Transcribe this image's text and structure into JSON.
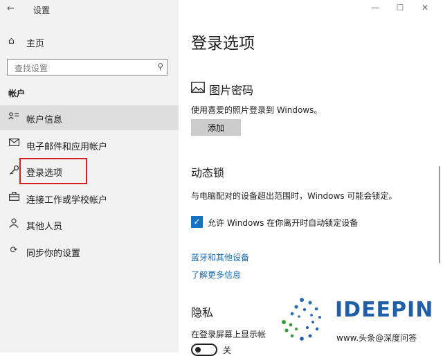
{
  "window": {
    "title": "设置",
    "back_glyph": "←",
    "controls": [
      "—",
      "☐",
      "✕"
    ]
  },
  "sidebar": {
    "home_label": "主页",
    "search_placeholder": "查找设置",
    "section_label": "帐户",
    "items": [
      {
        "label": "帐户信息",
        "icon": "person-card-icon",
        "active": true
      },
      {
        "label": "电子邮件和应用帐户",
        "icon": "mail-icon",
        "active": false
      },
      {
        "label": "登录选项",
        "icon": "key-icon",
        "active": false,
        "highlighted": true
      },
      {
        "label": "连接工作或学校帐户",
        "icon": "briefcase-icon",
        "active": false
      },
      {
        "label": "其他人员",
        "icon": "person-icon",
        "active": false
      },
      {
        "label": "同步你的设置",
        "icon": "sync-icon",
        "active": false
      }
    ]
  },
  "main": {
    "title": "登录选项",
    "picture_password": {
      "title": "图片密码",
      "description": "使用喜爱的照片登录到 Windows。",
      "button": "添加"
    },
    "dynamic_lock": {
      "title": "动态锁",
      "description": "与电脑配对的设备超出范围时，Windows 可能会锁定。",
      "checkbox_label": "允许 Windows 在你离开时自动锁定设备",
      "checked": true
    },
    "links": [
      "蓝牙和其他设备",
      "了解更多信息"
    ],
    "privacy": {
      "title": "隐私",
      "description": "在登录屏幕上显示帐",
      "toggle_label": "关",
      "toggle_on": false
    }
  },
  "watermark": {
    "brand": "IDEEPIN",
    "caption": "www.头条@深度问答"
  },
  "colors": {
    "accent": "#1672c4",
    "highlight_border": "#d42020",
    "link": "#1668b3"
  }
}
